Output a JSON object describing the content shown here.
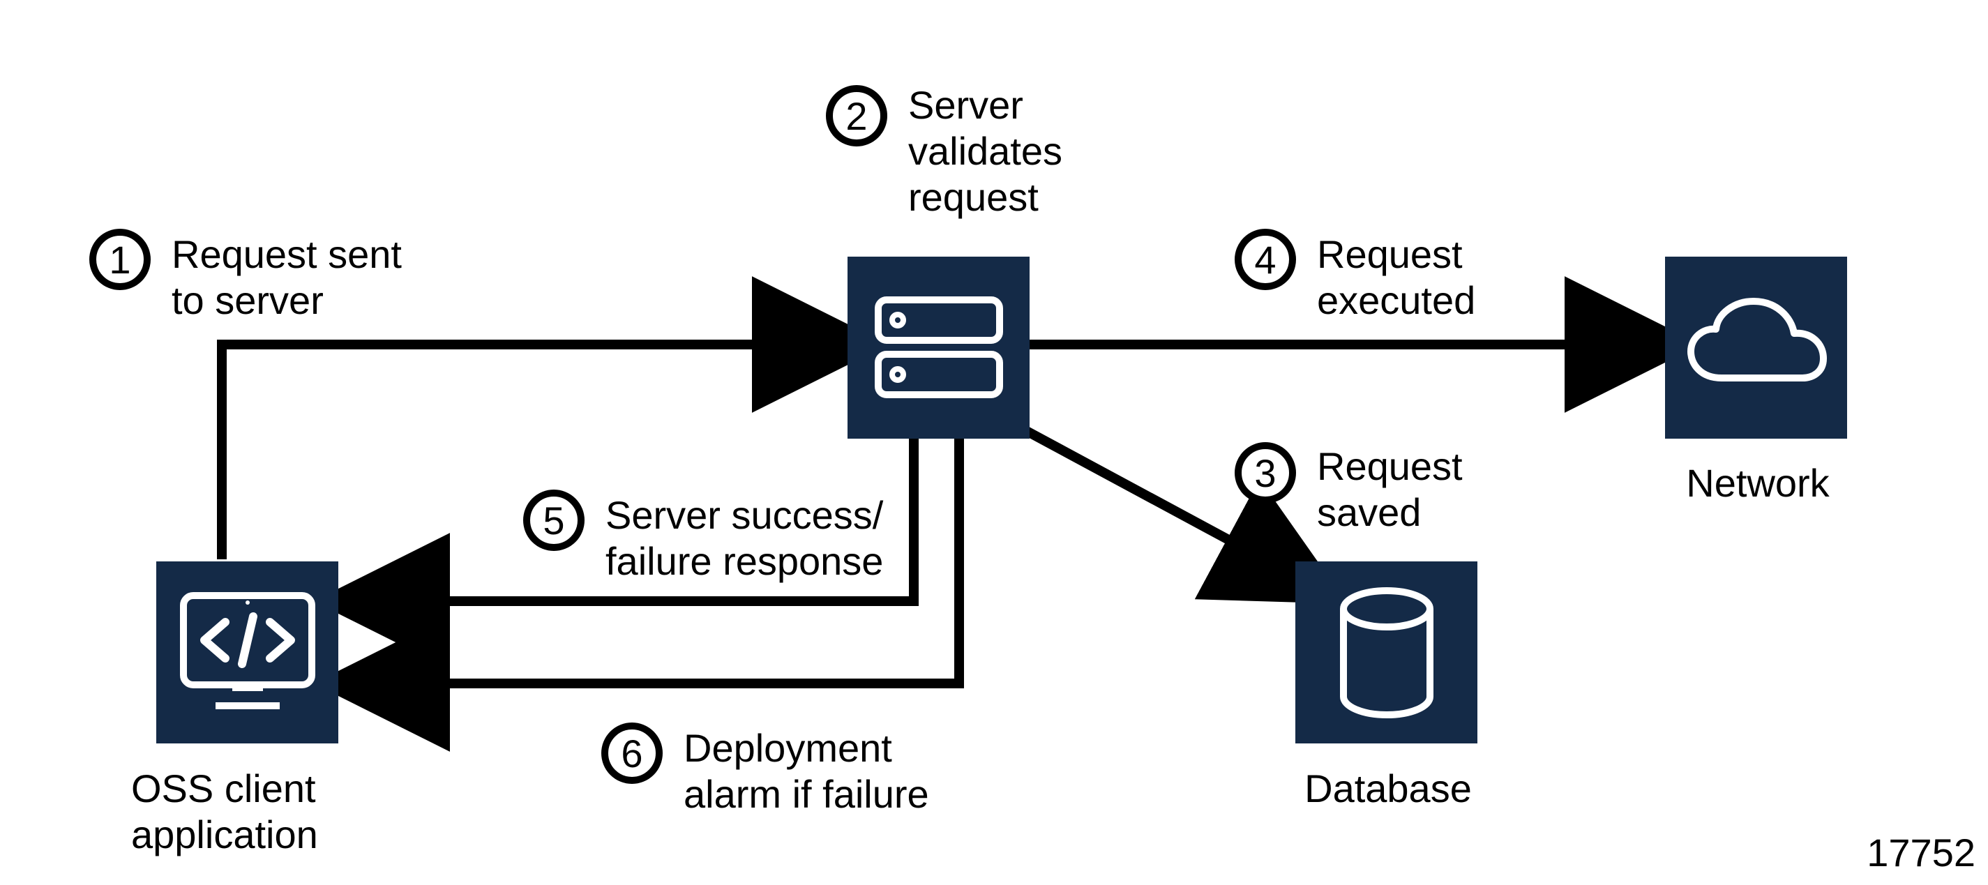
{
  "colors": {
    "node_bg": "#142a47",
    "stroke": "#000000",
    "icon_stroke": "#ffffff",
    "bg": "#ffffff"
  },
  "footer_id": "17752",
  "nodes": {
    "client": {
      "label": "OSS client\napplication"
    },
    "server": {
      "label": ""
    },
    "database": {
      "label": "Database"
    },
    "network": {
      "label": "Network"
    }
  },
  "steps": [
    {
      "n": "1",
      "text": "Request sent\nto server"
    },
    {
      "n": "2",
      "text": "Server\nvalidates\nrequest"
    },
    {
      "n": "3",
      "text": "Request\nsaved"
    },
    {
      "n": "4",
      "text": "Request\nexecuted"
    },
    {
      "n": "5",
      "text": "Server success/\nfailure response"
    },
    {
      "n": "6",
      "text": "Deployment\nalarm if failure"
    }
  ]
}
